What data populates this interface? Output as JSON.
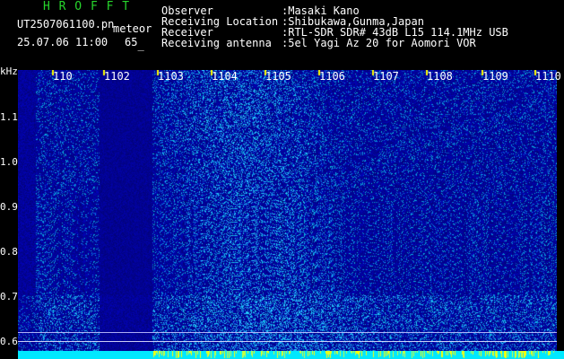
{
  "header": {
    "logo": "H R O F F T",
    "filename": "UT2507061100.pn",
    "mode": "meteor",
    "datetime": "25.07.06 11:00",
    "count": "65",
    "fields": [
      {
        "label": "Observer",
        "value": ":Masaki Kano"
      },
      {
        "label": "Receiving Location",
        "value": ":Shibukawa,Gunma,Japan"
      },
      {
        "label": "Receiver",
        "value": ":RTL-SDR SDR# 43dB L15 114.1MHz USB"
      },
      {
        "label": "Receiving antenna",
        "value": ":5el Yagi Az 20 for Aomori VOR"
      }
    ]
  },
  "axis": {
    "unit": "kHz",
    "y_ticks": [
      "1.1",
      "1.0",
      "0.9",
      "0.8",
      "0.7",
      "0.6"
    ],
    "x_ticks": [
      "110",
      "1102",
      "1103",
      "1104",
      "1105",
      "1106",
      "1107",
      "1108",
      "1109",
      "1110"
    ]
  },
  "colors": {
    "background": "#000000",
    "spectrogram_base": "#03028f",
    "cyan_band": "#00e8ff",
    "logo": "#27d52c",
    "info_text": "#ffffff",
    "tick_labels": "#ffff00"
  }
}
